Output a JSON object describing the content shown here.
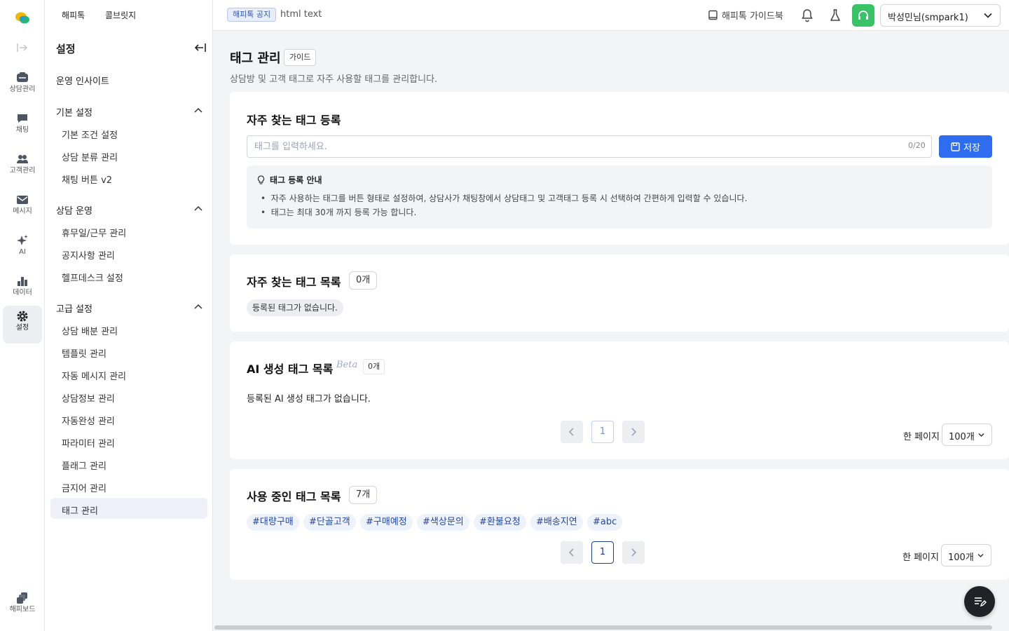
{
  "rail": {
    "items": [
      {
        "label": "상담관리"
      },
      {
        "label": "채팅"
      },
      {
        "label": "고객관리"
      },
      {
        "label": "메시지"
      },
      {
        "label": "AI"
      },
      {
        "label": "데이터"
      },
      {
        "label": "설정"
      },
      {
        "label": "해피보드"
      }
    ]
  },
  "sidebar": {
    "tabs": [
      "해피톡",
      "콜브릿지"
    ],
    "title": "설정",
    "insight": "운영 인사이트",
    "groups": [
      {
        "label": "기본 설정",
        "items": [
          "기본 조건 설정",
          "상담 분류 관리",
          "채팅 버튼 v2"
        ]
      },
      {
        "label": "상담 운영",
        "items": [
          "휴무일/근무 관리",
          "공지사항 관리",
          "헬프데스크 설정"
        ]
      },
      {
        "label": "고급 설정",
        "items": [
          "상담 배분 관리",
          "템플릿 관리",
          "자동 메시지 관리",
          "상담정보 관리",
          "자동완성 관리",
          "파라미터 관리",
          "플래그 관리",
          "금지어 관리",
          "태그 관리"
        ]
      }
    ]
  },
  "header": {
    "notice_badge": "해피톡 공지",
    "notice_text": "html text",
    "guidebook": "해피톡 가이드북",
    "user": "박성민님(smpark1)"
  },
  "page": {
    "title": "태그 관리",
    "guide": "가이드",
    "desc": "상담방 및 고객 태그로 자주 사용할 태그를 관리합니다."
  },
  "register": {
    "title": "자주 찾는 태그 등록",
    "placeholder": "태그를 입력하세요.",
    "value": "",
    "count": "0/20",
    "save": "저장",
    "info_title": "태그 등록 안내",
    "info_lines": [
      "자주 사용하는 태그를 버튼 형태로 설정하여, 상담사가 채팅창에서 상담태그 및 고객태그 등록 시 선택하여 간편하게 입력할 수 있습니다.",
      "태그는 최대 30개 까지 등록 가능 합니다."
    ]
  },
  "favorites": {
    "title": "자주 찾는 태그 목록",
    "count": "0개",
    "empty": "등록된 태그가 없습니다."
  },
  "ai": {
    "title": "AI 생성 태그 목록",
    "beta": "Beta",
    "count": "0개",
    "empty": "등록된 AI 생성 태그가 없습니다.",
    "page": "1",
    "per_label": "한 페이지",
    "per_value": "100개"
  },
  "inuse": {
    "title": "사용 중인 태그 목록",
    "count": "7개",
    "tags": [
      "#대량구매",
      "#단골고객",
      "#구매예정",
      "#색상문의",
      "#환불요청",
      "#배송지연",
      "#abc"
    ],
    "page": "1",
    "per_label": "한 페이지",
    "per_value": "100개"
  },
  "colors": {
    "accent": "#2f6df0",
    "headset": "#3ac267",
    "tag_text": "#2448a7"
  }
}
